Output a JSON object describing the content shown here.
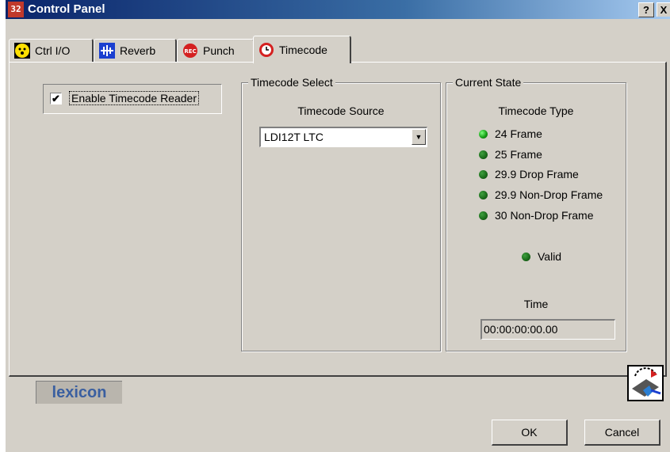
{
  "window": {
    "title": "Control Panel",
    "help": "?",
    "close": "X"
  },
  "tabs": [
    {
      "label": "Ctrl I/O",
      "icon": "smiley-icon"
    },
    {
      "label": "Reverb",
      "icon": "reverb-icon"
    },
    {
      "label": "Punch",
      "icon": "rec-icon"
    },
    {
      "label": "Timecode",
      "icon": "clock-icon",
      "active": true
    }
  ],
  "enable_reader": {
    "label": "Enable Timecode Reader",
    "checked": true
  },
  "timecode_select": {
    "title": "Timecode Select",
    "source_label": "Timecode Source",
    "source_value": "LDI12T LTC"
  },
  "current_state": {
    "title": "Current State",
    "type_label": "Timecode Type",
    "types": [
      "24 Frame",
      "25 Frame",
      "29.9 Drop Frame",
      "29.9 Non-Drop Frame",
      "30 Non-Drop Frame"
    ],
    "valid_label": "Valid",
    "time_label": "Time",
    "time_value": "00:00:00:00.00"
  },
  "logo_text": "lexicon",
  "buttons": {
    "ok": "OK",
    "cancel": "Cancel"
  },
  "colors": {
    "led_on": "#18a018",
    "title_bar": "#0a246a",
    "logo": "#3a5fa0"
  }
}
